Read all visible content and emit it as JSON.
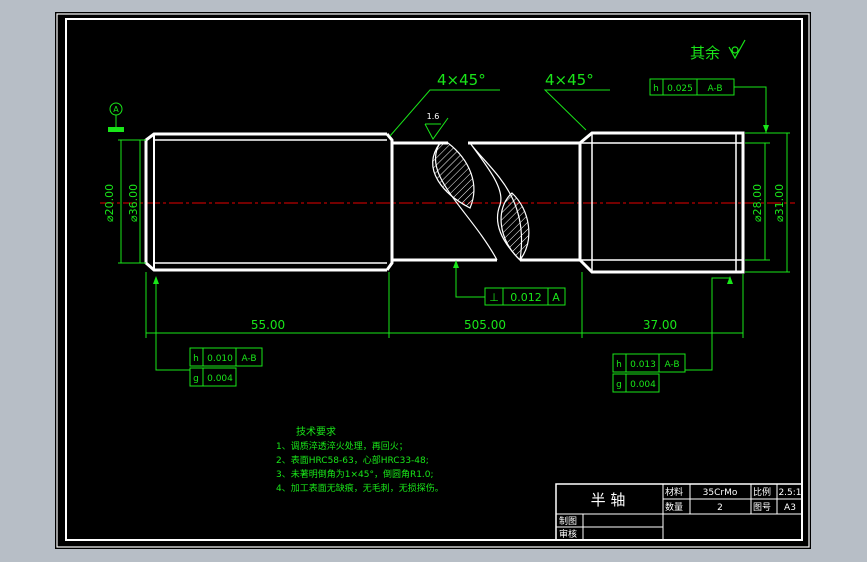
{
  "surface_finish": {
    "text": "其余"
  },
  "chamfer_left": "4×45°",
  "chamfer_right": "4×45°",
  "roughness": "1.6",
  "datum": "A",
  "dims": {
    "dia_left_a": "⌀20.00",
    "dia_left_b": "⌀36.00",
    "dia_right_a": "⌀28.00",
    "dia_right_b": "⌀31.00",
    "len_left": "55.00",
    "len_mid": "505.00",
    "len_right": "37.00"
  },
  "tol_top": {
    "sym": "h",
    "val": "0.025",
    "ref": "A-B"
  },
  "tol_left": [
    {
      "sym": "h",
      "val": "0.010",
      "ref": "A-B"
    },
    {
      "sym": "g",
      "val": "0.004",
      "ref": ""
    }
  ],
  "tol_right": [
    {
      "sym": "h",
      "val": "0.013",
      "ref": "A-B"
    },
    {
      "sym": "g",
      "val": "0.004",
      "ref": ""
    }
  ],
  "tol_mid": {
    "sym": "⊥",
    "val": "0.012",
    "ref": "A"
  },
  "notes": {
    "title": "技术要求",
    "lines": [
      "1、调质淬透淬火处理，再回火；",
      "2、表面HRC58-63，心部HRC33-48;",
      "3、未著明倒角为1×45°，倒圆角R1.0;",
      "4、加工表面无缺痕，无毛刺，无损探伤。"
    ]
  },
  "title_block": {
    "part_name": "半 轴",
    "material_label": "材料",
    "material_value": "35CrMo",
    "scale_label": "比例",
    "scale_value": "2.5:1",
    "qty_label": "数量",
    "qty_value": "2",
    "sheet_label": "图号",
    "sheet_value": "A3",
    "drawn_label": "制图",
    "checked_label": "审核"
  },
  "colors": {
    "background": "#000000",
    "frame": "#ffffff",
    "dimension": "#19e619",
    "centerline": "#e60000",
    "outer": "#b7bec6"
  }
}
